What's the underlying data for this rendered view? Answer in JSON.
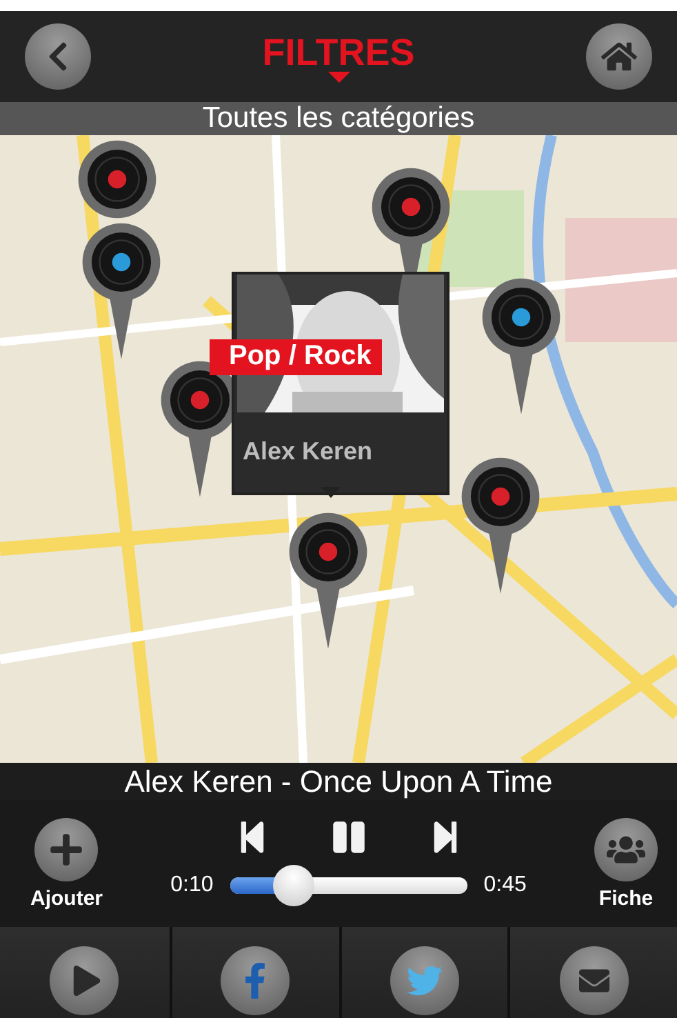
{
  "header": {
    "title": "FILTRES"
  },
  "category_bar": {
    "label": "Toutes les catégories"
  },
  "map": {
    "kind": "picture",
    "markers": [
      {
        "color": "#d8202a"
      },
      {
        "color": "#2a9ad8"
      },
      {
        "color": "#d8202a"
      },
      {
        "color": "#2a9ad8"
      },
      {
        "color": "#d8202a"
      },
      {
        "color": "#d8202a"
      },
      {
        "color": "#d8202a"
      }
    ],
    "popup": {
      "genre": "Pop / Rock",
      "artist": "Alex Keren"
    }
  },
  "player": {
    "track": "Alex Keren - Once Upon A Time",
    "add_label": "Ajouter",
    "info_label": "Fiche",
    "elapsed": "0:10",
    "total": "0:45",
    "level": 0.27,
    "playing": true
  },
  "tabs": [
    {
      "kind": "play"
    },
    {
      "kind": "facebook"
    },
    {
      "kind": "twitter"
    },
    {
      "kind": "mail"
    }
  ]
}
